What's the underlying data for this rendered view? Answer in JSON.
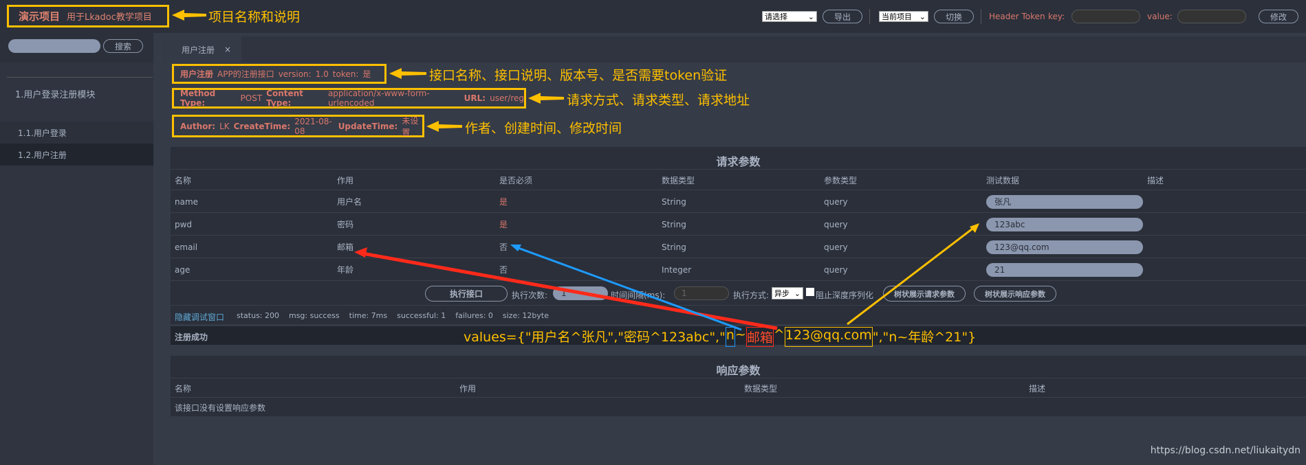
{
  "header": {
    "project_name": "演示项目",
    "project_desc": "用于Lkadoc教学项目",
    "export_select": "请选择",
    "export_button": "导出",
    "project_select": "当前项目",
    "switch_button": "切换",
    "header_token_label": "Header Token",
    "key_label": "key:",
    "value_label": "value:",
    "modify_button": "修改"
  },
  "sidebar": {
    "search_button": "搜索",
    "module": "1.用户登录注册模块",
    "items": [
      {
        "label": "1.1.用户登录"
      },
      {
        "label": "1.2.用户注册"
      }
    ]
  },
  "tabs": [
    {
      "label": "用户注册",
      "close": "×"
    }
  ],
  "api_info": {
    "name": "用户注册",
    "desc": "APP的注册接口",
    "version_label": "version:",
    "version": "1.0",
    "token_label": "token:",
    "token": "是",
    "method_label": "Method Type:",
    "method": "POST",
    "content_type_label": "Content Type:",
    "content_type": "application/x-www-form-urlencoded",
    "url_label": "URL:",
    "url": "user/reg",
    "author_label": "Author:",
    "author": "LK",
    "create_label": "CreateTime:",
    "create_time": "2021-08-08",
    "update_label": "UpdateTime:",
    "update_time": "未设置"
  },
  "request": {
    "title": "请求参数",
    "columns": [
      "名称",
      "作用",
      "是否必须",
      "数据类型",
      "参数类型",
      "测试数据",
      "描述"
    ],
    "rows": [
      {
        "name": "name",
        "desc": "用户名",
        "required": "是",
        "type": "String",
        "param_type": "query",
        "test": "张凡"
      },
      {
        "name": "pwd",
        "desc": "密码",
        "required": "是",
        "type": "String",
        "param_type": "query",
        "test": "123abc"
      },
      {
        "name": "email",
        "desc": "邮箱",
        "required": "否",
        "type": "String",
        "param_type": "query",
        "test": "123@qq.com"
      },
      {
        "name": "age",
        "desc": "年龄",
        "required": "否",
        "type": "Integer",
        "param_type": "query",
        "test": "21"
      }
    ]
  },
  "exec": {
    "run_button": "执行接口",
    "count_label": "执行次数:",
    "count": "1",
    "interval_label": "时间间隔(ms):",
    "interval": "1",
    "mode_label": "执行方式:",
    "mode": "异步",
    "no_deep_label": "阻止深度序列化",
    "tree_req_button": "树状展示请求参数",
    "tree_resp_button": "树状展示响应参数"
  },
  "status": {
    "hide_debug": "隐藏调试窗口",
    "text": "status: 200    msg: success    time: 7ms    successful: 1    failures: 0    size: 12byte",
    "result": "注册成功"
  },
  "response": {
    "title": "响应参数",
    "columns": [
      "名称",
      "作用",
      "数据类型",
      "描述"
    ],
    "empty": "该接口没有设置响应参数"
  },
  "annotations": {
    "a1": "项目名称和说明",
    "a2": "接口名称、接口说明、版本号、是否需要token验证",
    "a3": "请求方式、请求类型、请求地址",
    "a4": "作者、创建时间、修改时间",
    "values_prefix": "values={\"用户名^张凡\",\"密码^123abc\",\"",
    "values_n": "n",
    "values_tilde": "~",
    "values_email": "邮箱",
    "values_caret": "^",
    "values_mail": "123@qq.com",
    "values_suffix": "\",\"n~年龄^21\"}"
  },
  "watermark": "https://blog.csdn.net/liukaitydn",
  "colors": {
    "accent": "#ffc000",
    "label_red": "#d9776b",
    "bg": "#353b47"
  }
}
